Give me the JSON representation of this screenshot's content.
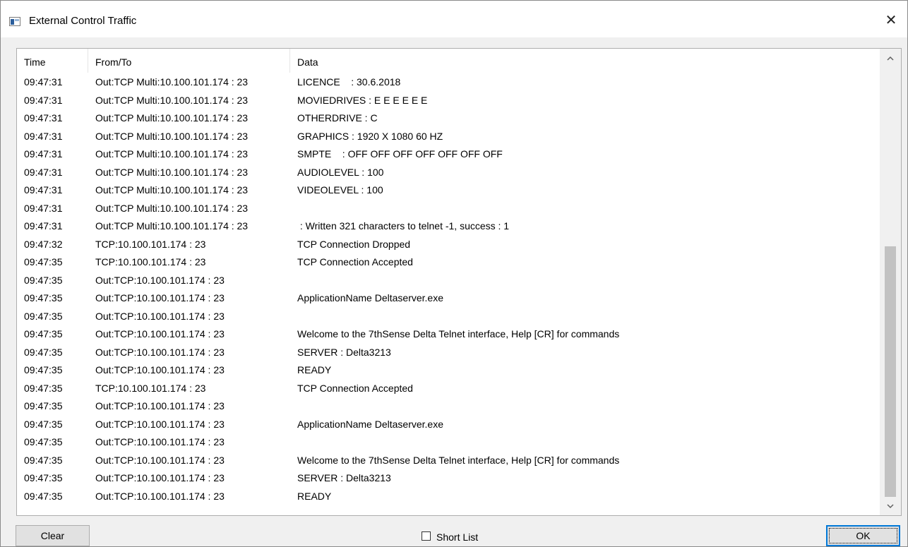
{
  "window": {
    "title": "External Control Traffic",
    "close_glyph": "✕"
  },
  "columns": [
    "Time",
    "From/To",
    "Data"
  ],
  "rows": [
    {
      "time": "09:47:31",
      "from": "Out:TCP Multi:10.100.101.174 : 23",
      "data": "LICENCE    : 30.6.2018"
    },
    {
      "time": "09:47:31",
      "from": "Out:TCP Multi:10.100.101.174 : 23",
      "data": "MOVIEDRIVES : E E E E E E"
    },
    {
      "time": "09:47:31",
      "from": "Out:TCP Multi:10.100.101.174 : 23",
      "data": "OTHERDRIVE : C"
    },
    {
      "time": "09:47:31",
      "from": "Out:TCP Multi:10.100.101.174 : 23",
      "data": "GRAPHICS : 1920 X 1080 60 HZ"
    },
    {
      "time": "09:47:31",
      "from": "Out:TCP Multi:10.100.101.174 : 23",
      "data": "SMPTE    : OFF OFF OFF OFF OFF OFF OFF"
    },
    {
      "time": "09:47:31",
      "from": "Out:TCP Multi:10.100.101.174 : 23",
      "data": "AUDIOLEVEL : 100"
    },
    {
      "time": "09:47:31",
      "from": "Out:TCP Multi:10.100.101.174 : 23",
      "data": "VIDEOLEVEL : 100"
    },
    {
      "time": "09:47:31",
      "from": "Out:TCP Multi:10.100.101.174 : 23",
      "data": ""
    },
    {
      "time": "09:47:31",
      "from": "Out:TCP Multi:10.100.101.174 : 23",
      "data": " : Written 321 characters to telnet -1, success : 1"
    },
    {
      "time": "09:47:32",
      "from": "TCP:10.100.101.174 : 23",
      "data": "TCP Connection Dropped"
    },
    {
      "time": "09:47:35",
      "from": "TCP:10.100.101.174 : 23",
      "data": "TCP Connection Accepted"
    },
    {
      "time": "09:47:35",
      "from": "Out:TCP:10.100.101.174 : 23",
      "data": ""
    },
    {
      "time": "09:47:35",
      "from": "Out:TCP:10.100.101.174 : 23",
      "data": "ApplicationName Deltaserver.exe"
    },
    {
      "time": "09:47:35",
      "from": "Out:TCP:10.100.101.174 : 23",
      "data": ""
    },
    {
      "time": "09:47:35",
      "from": "Out:TCP:10.100.101.174 : 23",
      "data": "Welcome to the 7thSense Delta Telnet interface, Help [CR] for commands"
    },
    {
      "time": "09:47:35",
      "from": "Out:TCP:10.100.101.174 : 23",
      "data": "SERVER : Delta3213"
    },
    {
      "time": "09:47:35",
      "from": "Out:TCP:10.100.101.174 : 23",
      "data": "READY"
    },
    {
      "time": "09:47:35",
      "from": "TCP:10.100.101.174 : 23",
      "data": "TCP Connection Accepted"
    },
    {
      "time": "09:47:35",
      "from": "Out:TCP:10.100.101.174 : 23",
      "data": ""
    },
    {
      "time": "09:47:35",
      "from": "Out:TCP:10.100.101.174 : 23",
      "data": "ApplicationName Deltaserver.exe"
    },
    {
      "time": "09:47:35",
      "from": "Out:TCP:10.100.101.174 : 23",
      "data": ""
    },
    {
      "time": "09:47:35",
      "from": "Out:TCP:10.100.101.174 : 23",
      "data": "Welcome to the 7thSense Delta Telnet interface, Help [CR] for commands"
    },
    {
      "time": "09:47:35",
      "from": "Out:TCP:10.100.101.174 : 23",
      "data": "SERVER : Delta3213"
    },
    {
      "time": "09:47:35",
      "from": "Out:TCP:10.100.101.174 : 23",
      "data": "READY"
    }
  ],
  "scrollbar": {
    "up_glyph": "^",
    "down_glyph": "v"
  },
  "footer": {
    "clear_label": "Clear",
    "shortlist_label": "Short List",
    "shortlist_checked": false,
    "ok_label": "OK"
  },
  "colors": {
    "focus_border": "#0078d7",
    "thumb": "#c2c2c2"
  }
}
